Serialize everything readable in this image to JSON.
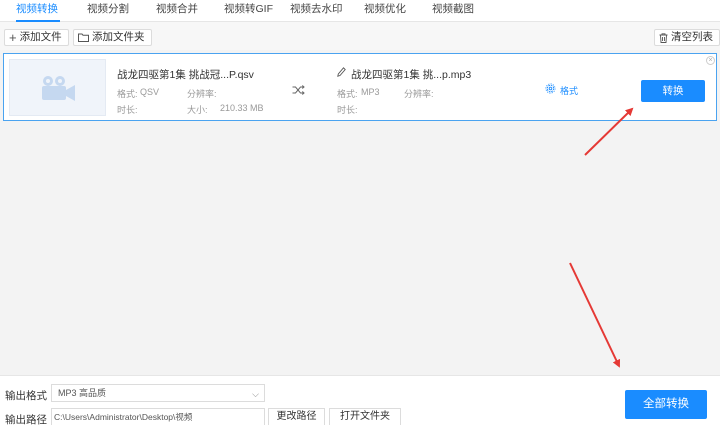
{
  "tabs": [
    {
      "label": "视频转换",
      "active": true
    },
    {
      "label": "视频分割"
    },
    {
      "label": "视频合并"
    },
    {
      "label": "视频转GIF"
    },
    {
      "label": "视频去水印"
    },
    {
      "label": "视频优化"
    },
    {
      "label": "视频截图"
    }
  ],
  "toolbar": {
    "add_file": "添加文件",
    "add_folder": "添加文件夹",
    "clear_list": "清空列表"
  },
  "file": {
    "source_name": "战龙四驱第1集 挑战冠...P.qsv",
    "source_format_label": "格式:",
    "source_format": "QSV",
    "source_resolution_label": "分辨率:",
    "source_duration_label": "时长:",
    "source_size_label": "大小:",
    "source_size": "210.33 MB",
    "target_name": "战龙四驱第1集 挑...p.mp3",
    "target_format_label": "格式:",
    "target_format": "MP3",
    "target_resolution_label": "分辨率:",
    "target_duration_label": "时长:",
    "format_settings": "格式",
    "convert_button": "转换"
  },
  "bottom": {
    "output_format_label": "输出格式",
    "output_format_value": "MP3  高品质",
    "output_path_label": "输出路径",
    "output_path_value": "C:\\Users\\Administrator\\Desktop\\视频",
    "change_path": "更改路径",
    "open_folder": "打开文件夹",
    "convert_all": "全部转换"
  },
  "colors": {
    "accent": "#1a8cff",
    "annotation_arrow": "#e53935"
  }
}
